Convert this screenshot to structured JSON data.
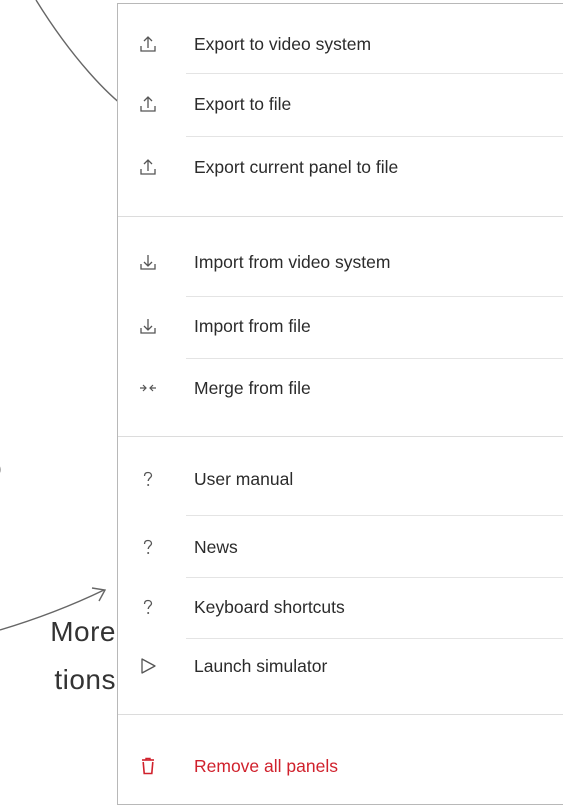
{
  "callouts": {
    "left_fragment": "o",
    "more_line1": "More",
    "more_line2": "tions"
  },
  "menu": {
    "export_group": [
      {
        "label": "Export to video system",
        "icon": "export-icon"
      },
      {
        "label": "Export to file",
        "icon": "export-icon"
      },
      {
        "label": "Export current panel to file",
        "icon": "export-icon"
      }
    ],
    "import_group": [
      {
        "label": "Import from video system",
        "icon": "import-icon"
      },
      {
        "label": "Import from file",
        "icon": "import-icon"
      },
      {
        "label": "Merge from file",
        "icon": "merge-icon"
      }
    ],
    "help_group": [
      {
        "label": "User manual",
        "icon": "help-icon"
      },
      {
        "label": "News",
        "icon": "help-icon"
      },
      {
        "label": "Keyboard shortcuts",
        "icon": "help-icon"
      },
      {
        "label": "Launch simulator",
        "icon": "play-icon"
      }
    ],
    "danger_group": [
      {
        "label": "Remove all panels",
        "icon": "trash-icon",
        "color": "#d0212c"
      }
    ]
  }
}
